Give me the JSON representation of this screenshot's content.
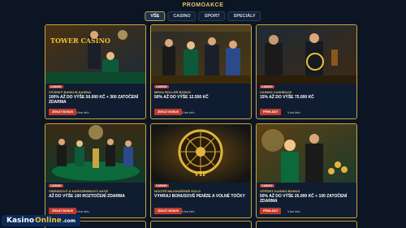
{
  "page": {
    "title": "PROMOAKCE"
  },
  "tabs": [
    {
      "label": "VŠE",
      "active": true
    },
    {
      "label": "CASINO",
      "active": false
    },
    {
      "label": "SPORT",
      "active": false
    },
    {
      "label": "SPECIÁLY",
      "active": false
    }
  ],
  "cards": [
    {
      "tag": "CASINO",
      "title": "VÍTÁSKÝ BANKUS KASINA",
      "desc": "100% AŽ DO VÝŠE 50.000 KČ + 300 ZATOČENÍ ZDARMA",
      "button": "ZÍSKAT BONUS",
      "more": "Více info",
      "art_text": "TOWER CASINO",
      "colors": {
        "bg1": "#3a2612",
        "bg2": "#1b2a38"
      }
    },
    {
      "tag": "CASINO",
      "title": "MEGA ROLLER BONUS",
      "desc": "50% AŽ DO VÝŠE 12.500 KČ",
      "button": "ZÍSKAT BONUS",
      "more": "Více info",
      "art_text": "",
      "colors": {
        "bg1": "#2a2a2a",
        "bg2": "#4a3a12"
      }
    },
    {
      "tag": "CASINO",
      "title": "CASINO CASHBACK",
      "desc": "15% AŽ DO VÝŠE 75.000 KČ",
      "button": "PŘIHLÁSIT",
      "more": "Více info",
      "art_text": "",
      "colors": {
        "bg1": "#1f2a36",
        "bg2": "#3b2a14"
      }
    },
    {
      "tag": "CASINO",
      "title": "VÍKENDOVÝ & NAROZENINOVÝ AKCE",
      "desc": "AŽ DO VÝŠE 100 ROZTOČENÍ ZDARMA",
      "button": "ZÍSKAT BONUS",
      "more": "Více info",
      "art_text": "",
      "colors": {
        "bg1": "#0f3a2a",
        "bg2": "#3a2a14"
      }
    },
    {
      "tag": "CASINO",
      "title": "NOCITÉ MILIONÁŘSKÉ KOLO",
      "desc": "VYHRAJ BONUSOVÉ PENÍZE A VOLNÉ TOČKY",
      "button": "ZÍSKAT BONUS",
      "more": "Více info",
      "art_text": "VIP",
      "colors": {
        "bg1": "#1a1a1a",
        "bg2": "#4a3208"
      }
    },
    {
      "tag": "CASINO",
      "title": "VÍTĚZNÝ KASINO BONUS",
      "desc": "50% AŽ DO VÝŠE 25.000 KČ + 100 ZATOČENÍ ZDARMA",
      "button": "PŘIHLÁSIT",
      "more": "Více info",
      "art_text": "",
      "colors": {
        "bg1": "#3a2a12",
        "bg2": "#1f3a2a"
      }
    }
  ],
  "logo": {
    "part1": "Kasino",
    "part2": "Online",
    "part3": ".com"
  }
}
